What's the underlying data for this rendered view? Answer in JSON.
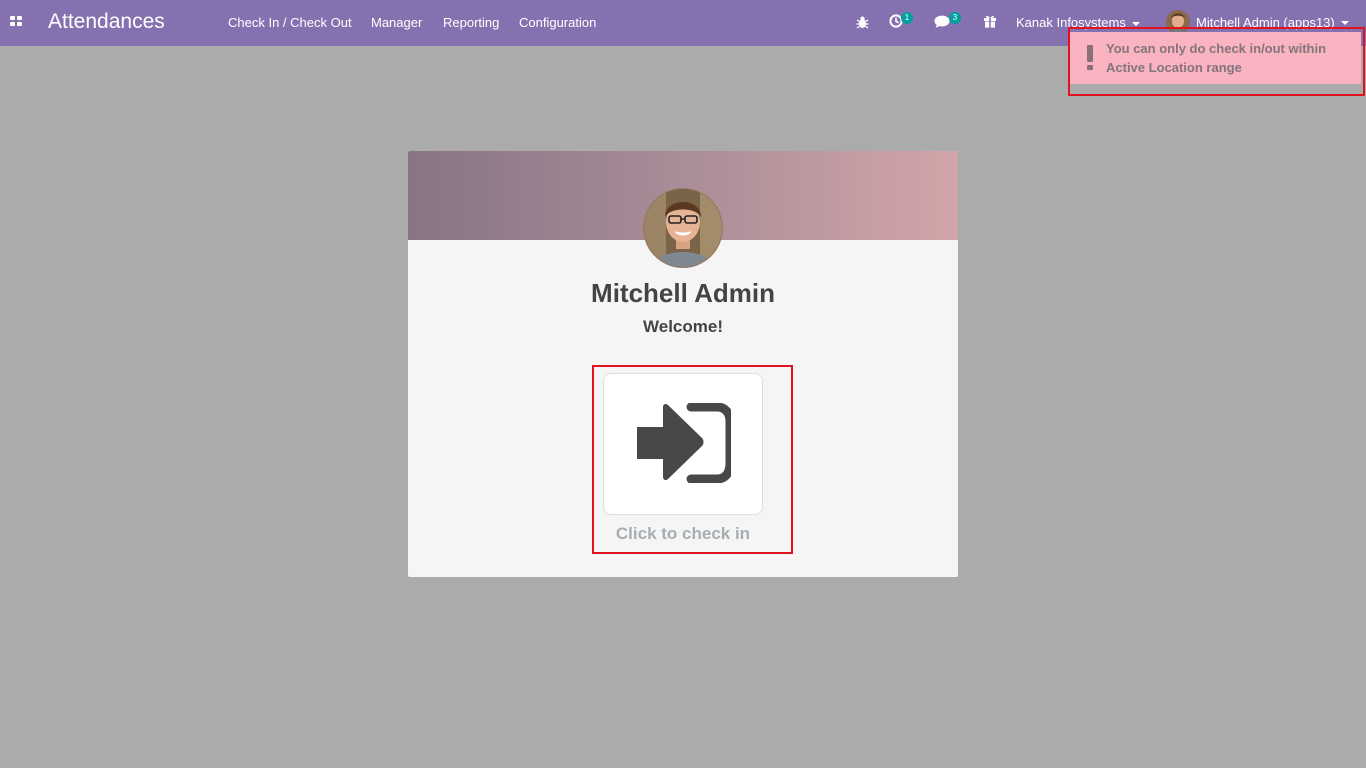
{
  "navbar": {
    "app_title": "Attendances",
    "menu": [
      {
        "label": "Check In / Check Out"
      },
      {
        "label": "Manager"
      },
      {
        "label": "Reporting"
      },
      {
        "label": "Configuration"
      }
    ],
    "activity_count": "1",
    "messages_count": "3",
    "company": "Kanak Infosystems",
    "user": "Mitchell Admin (apps13)"
  },
  "notification": {
    "message": "You can only do check in/out within Active Location range"
  },
  "kiosk": {
    "employee_name": "Mitchell Admin",
    "greeting": "Welcome!",
    "checkin_label": "Click to check in"
  },
  "colors": {
    "navbar": "#8671b0",
    "background": "#ababab",
    "notification_bg": "#f9b3c1",
    "badge": "#00a09d",
    "highlight": "#e0141e"
  },
  "icons": [
    "apps-grid-icon",
    "bug-icon",
    "clock-icon",
    "chat-icon",
    "gift-icon",
    "warning-icon",
    "sign-in-icon"
  ]
}
